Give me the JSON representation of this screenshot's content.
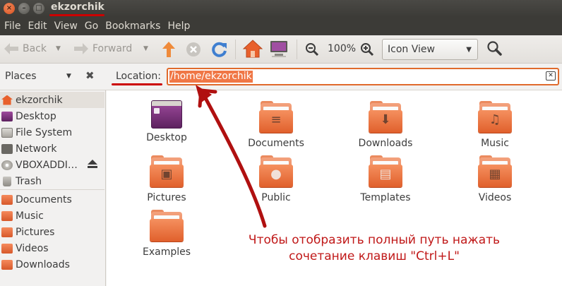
{
  "window": {
    "title": "ekzorchik",
    "close_glyph": "×",
    "min_glyph": "–",
    "max_glyph": "□"
  },
  "menu": [
    "File",
    "Edit",
    "View",
    "Go",
    "Bookmarks",
    "Help"
  ],
  "toolbar": {
    "back_label": "Back",
    "forward_label": "Forward",
    "zoom_level": "100%",
    "view_mode": "Icon View"
  },
  "location_bar": {
    "places_label": "Places",
    "location_label": "Location:",
    "path": "/home/ekzorchik"
  },
  "sidebar": {
    "items": [
      {
        "label": "ekzorchik",
        "icon": "home-icon"
      },
      {
        "label": "Desktop",
        "icon": "folder-icon"
      },
      {
        "label": "File System",
        "icon": "drive-icon"
      },
      {
        "label": "Network",
        "icon": "network-icon"
      },
      {
        "label": "VBOXADDI…",
        "icon": "cd-icon"
      },
      {
        "label": "Trash",
        "icon": "trash-icon"
      },
      {
        "label": "Documents",
        "icon": "folder-icon"
      },
      {
        "label": "Music",
        "icon": "folder-icon"
      },
      {
        "label": "Pictures",
        "icon": "folder-icon"
      },
      {
        "label": "Videos",
        "icon": "folder-icon"
      },
      {
        "label": "Downloads",
        "icon": "folder-icon"
      }
    ]
  },
  "files": [
    {
      "label": "Desktop"
    },
    {
      "label": "Documents"
    },
    {
      "label": "Downloads"
    },
    {
      "label": "Music"
    },
    {
      "label": "Pictures"
    },
    {
      "label": "Public"
    },
    {
      "label": "Templates"
    },
    {
      "label": "Videos"
    },
    {
      "label": "Examples"
    }
  ],
  "annotation": {
    "line1": "Чтобы отобразить полный путь нажать",
    "line2": "сочетание клавиш \"Ctrl+L\""
  },
  "colors": {
    "accent": "#f07746",
    "annotation_red": "#c01818"
  }
}
